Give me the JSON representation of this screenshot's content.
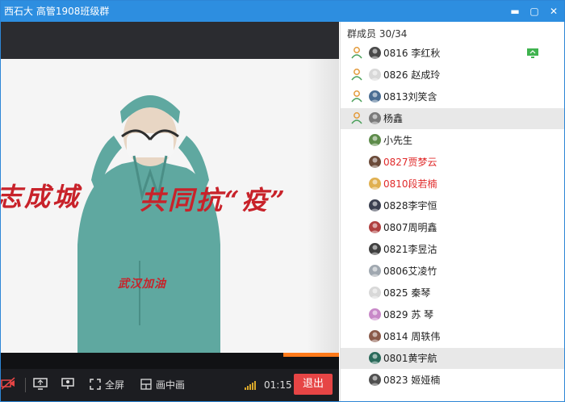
{
  "window": {
    "title": "西石大 高管1908班级群",
    "controls": {
      "minimize": "▬",
      "maximize": "▢",
      "close": "✕"
    }
  },
  "slide": {
    "line_left": "志成城",
    "line_right": "共同抗“疫”",
    "sub_caption": "武汉加油"
  },
  "player": {
    "fullscreen_label": "全屏",
    "pip_label": "画中画",
    "elapsed": "01:15",
    "exit_label": "退出"
  },
  "members": {
    "header": "群成员 30/34",
    "items": [
      {
        "label": "0816  李红秋",
        "red": false,
        "role": true,
        "avatar": "#4a4a4a",
        "screen": true
      },
      {
        "label": "0826  赵成玲",
        "red": false,
        "role": true,
        "avatar": "#d8d8d8",
        "screen": false
      },
      {
        "label": "0813刘笑含",
        "red": false,
        "role": true,
        "avatar": "#4a6d93",
        "screen": false
      },
      {
        "label": "杨鑫",
        "red": false,
        "role": true,
        "avatar": "#7a7a7a",
        "screen": false,
        "selected": true
      },
      {
        "label": "小先生",
        "red": false,
        "role": false,
        "avatar": "#5d8b4a",
        "screen": false
      },
      {
        "label": "0827贾梦云",
        "red": true,
        "role": false,
        "avatar": "#6b4b3a",
        "screen": false
      },
      {
        "label": "0810段若楠",
        "red": true,
        "role": false,
        "avatar": "#e0b050",
        "screen": false
      },
      {
        "label": "0828李宇恒",
        "red": false,
        "role": false,
        "avatar": "#3a3f50",
        "screen": false
      },
      {
        "label": "0807周明鑫",
        "red": false,
        "role": false,
        "avatar": "#b04040",
        "screen": false
      },
      {
        "label": "0821李昱沽",
        "red": false,
        "role": false,
        "avatar": "#404040",
        "screen": false
      },
      {
        "label": "0806艾凌竹",
        "red": false,
        "role": false,
        "avatar": "#a0a8b0",
        "screen": false
      },
      {
        "label": "0825  秦琴",
        "red": false,
        "role": false,
        "avatar": "#d8d8d8",
        "screen": false
      },
      {
        "label": "0829 苏 琴",
        "red": false,
        "role": false,
        "avatar": "#c888c8",
        "screen": false
      },
      {
        "label": "0814  周轶伟",
        "red": false,
        "role": false,
        "avatar": "#8a5a4a",
        "screen": false
      },
      {
        "label": "0801黄宇航",
        "red": false,
        "role": false,
        "avatar": "#2a6a5a",
        "screen": false,
        "selected": true
      },
      {
        "label": "0823 姬娅楠",
        "red": false,
        "role": false,
        "avatar": "#505050",
        "screen": false
      }
    ]
  },
  "colors": {
    "titlebar": "#2d8ee0",
    "exit": "#e64545",
    "progress": "#ff7a1a",
    "slide_red": "#c8222a",
    "member_red": "#e02a2a",
    "role_icon": "#e39a3a"
  }
}
